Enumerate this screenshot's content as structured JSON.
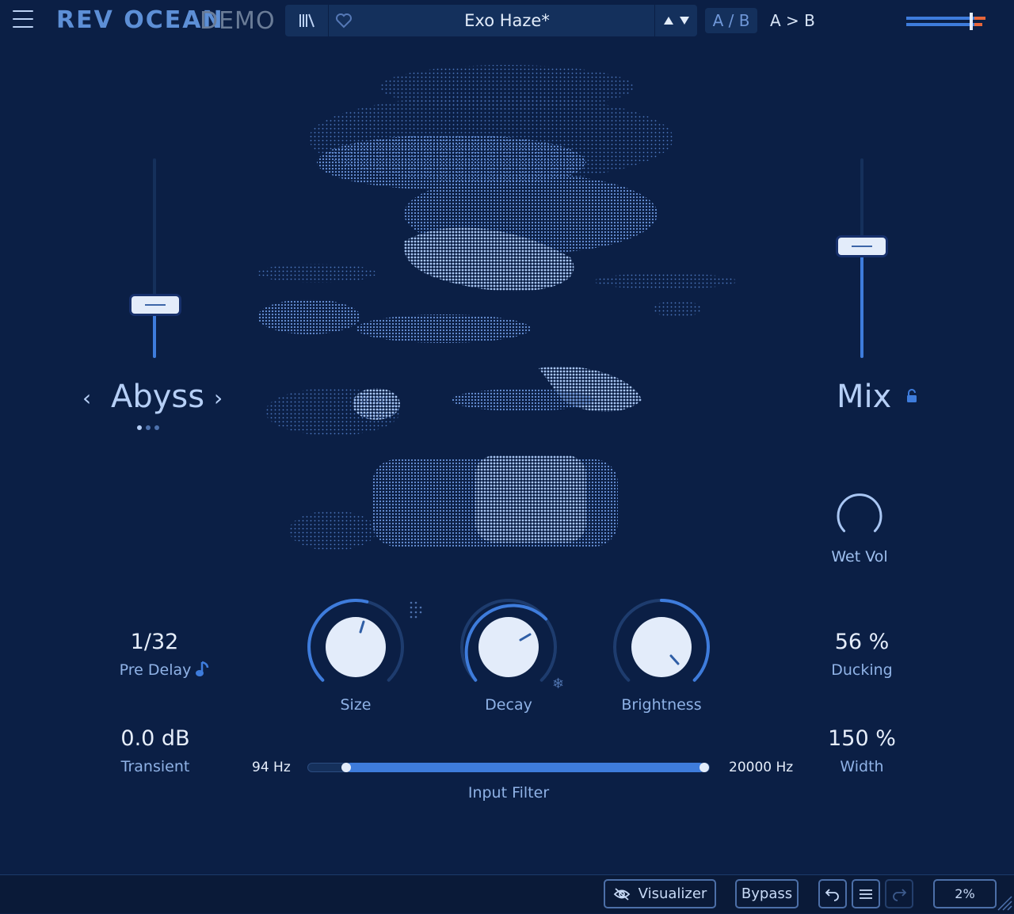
{
  "header": {
    "brand": "REV OCEAN",
    "demo_tag": "DEMO",
    "preset_name": "Exo Haze*",
    "ab_toggle": "A / B",
    "ab_copy": "A > B",
    "icons": [
      "menu-icon",
      "library-icon",
      "heart-icon",
      "preset-up-down-icon",
      "output-meter"
    ]
  },
  "left": {
    "mode_name": "Abyss",
    "mode_pages": 3,
    "mode_page_active": 1,
    "pre_delay": {
      "value": "1/32",
      "label": "Pre Delay"
    },
    "transient": {
      "value": "0.0 dB",
      "label": "Transient"
    },
    "fader_level": 0.27
  },
  "right": {
    "mix_label": "Mix",
    "mix_level": 0.57,
    "wet_vol": {
      "label": "Wet Vol",
      "level": 0.0
    },
    "ducking": {
      "value": "56 %",
      "label": "Ducking"
    },
    "width": {
      "value": "150 %",
      "label": "Width"
    }
  },
  "knobs": [
    {
      "label": "Size",
      "level": 0.55
    },
    {
      "label": "Decay",
      "level": 0.65
    },
    {
      "label": "Brightness",
      "level": 0.88
    }
  ],
  "input_filter": {
    "label": "Input Filter",
    "low": "94 Hz",
    "high": "20000 Hz"
  },
  "footer": {
    "visualizer": "Visualizer",
    "bypass": "Bypass",
    "zoom": "2%"
  },
  "colors": {
    "background": "#0b1f45",
    "accent": "#3e7cdc",
    "panel": "#14305c",
    "meter_peak": "#e8663a"
  }
}
